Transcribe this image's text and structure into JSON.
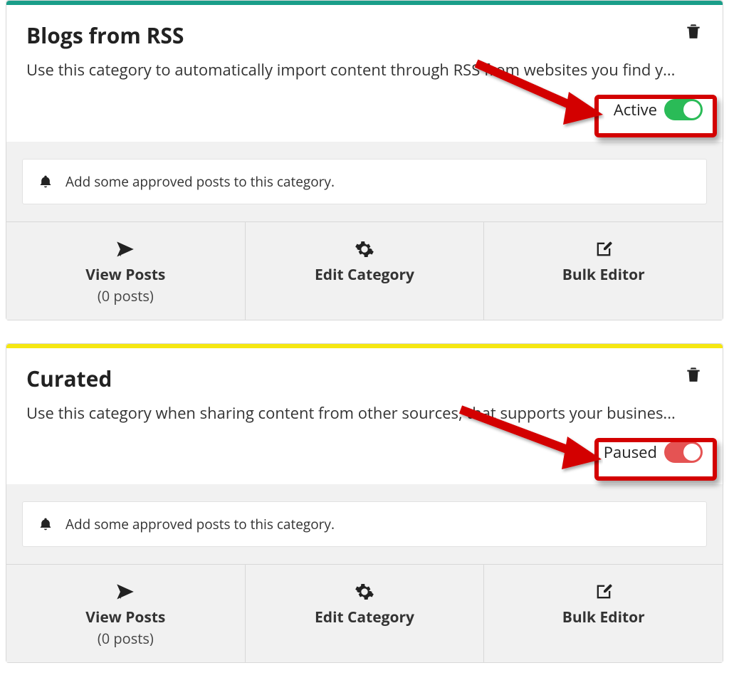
{
  "cards": [
    {
      "accent": "#1a9e89",
      "title": "Blogs from RSS",
      "description": "Use this category to automatically import content through RSS from websites you find y...",
      "status_label": "Active",
      "status_on": true,
      "notice": "Add some approved posts to this category.",
      "actions": {
        "view_posts": {
          "label": "View Posts",
          "sub": "(0 posts)"
        },
        "edit_category": {
          "label": "Edit Category"
        },
        "bulk_editor": {
          "label": "Bulk Editor"
        }
      }
    },
    {
      "accent": "#f5e711",
      "title": "Curated",
      "description": "Use this category when sharing content from other sources, that supports your busines...",
      "status_label": "Paused",
      "status_on": false,
      "notice": "Add some approved posts to this category.",
      "actions": {
        "view_posts": {
          "label": "View Posts",
          "sub": "(0 posts)"
        },
        "edit_category": {
          "label": "Edit Category"
        },
        "bulk_editor": {
          "label": "Bulk Editor"
        }
      }
    }
  ]
}
